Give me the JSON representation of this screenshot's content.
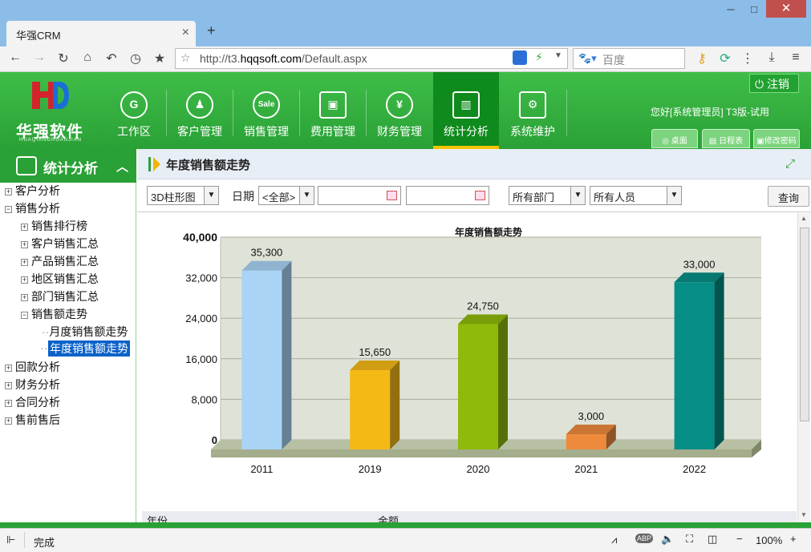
{
  "browser": {
    "tab_title": "华强CRM",
    "tab_close": "×",
    "new_tab": "+",
    "url_prefix": "http://t3.",
    "url_domain": "hqqsoft.com",
    "url_path": "/Default.aspx",
    "search_placeholder": "百度",
    "win_min": "─",
    "win_max": "□",
    "win_close": "✕"
  },
  "header": {
    "logo_text": "华强软件",
    "logo_sub": "HUAQIANGRUANJIAN",
    "logout_label": "注销",
    "greeting": "您好[系统管理员] T3版-试用",
    "modules": [
      {
        "label": "工作区",
        "icon": "G"
      },
      {
        "label": "客户管理",
        "icon": "♟"
      },
      {
        "label": "销售管理",
        "icon": "Sale"
      },
      {
        "label": "费用管理",
        "icon": "▣"
      },
      {
        "label": "财务管理",
        "icon": "¥"
      },
      {
        "label": "统计分析",
        "icon": "▥"
      },
      {
        "label": "系统维护",
        "icon": "⚙"
      }
    ],
    "quick": [
      "桌面",
      "日程表",
      "修改密码"
    ]
  },
  "sidebar": {
    "title": "统计分析",
    "collapse_icon": "︿",
    "items": [
      {
        "label": "客户分析",
        "pm": "+"
      },
      {
        "label": "销售分析",
        "pm": "−"
      },
      {
        "label": "销售排行榜",
        "pm": "+"
      },
      {
        "label": "客户销售汇总",
        "pm": "+"
      },
      {
        "label": "产品销售汇总",
        "pm": "+"
      },
      {
        "label": "地区销售汇总",
        "pm": "+"
      },
      {
        "label": "部门销售汇总",
        "pm": "+"
      },
      {
        "label": "销售额走势",
        "pm": "−"
      },
      {
        "label": "月度销售额走势",
        "pm": ""
      },
      {
        "label": "年度销售额走势",
        "pm": ""
      },
      {
        "label": "回款分析",
        "pm": "+"
      },
      {
        "label": "财务分析",
        "pm": "+"
      },
      {
        "label": "合同分析",
        "pm": "+"
      },
      {
        "label": "售前售后",
        "pm": "+"
      }
    ]
  },
  "content": {
    "title": "年度销售额走势",
    "chart_type_select": "3D柱形图",
    "date_label": "日期",
    "date_range_select": "<全部>",
    "date_from": "",
    "date_to": "",
    "dept_select": "所有部门",
    "person_select": "所有人员",
    "query_button": "查询",
    "table_col_year": "年份",
    "table_col_amount": "金额"
  },
  "status": {
    "text": "完成",
    "zoom": "100%",
    "zoom_minus": "−",
    "zoom_plus": "+"
  },
  "chart_data": {
    "type": "bar",
    "title": "年度销售额走势",
    "categories": [
      "2011",
      "2019",
      "2020",
      "2021",
      "2022"
    ],
    "values": [
      35300,
      15650,
      24750,
      3000,
      33000
    ],
    "value_labels": [
      "35,300",
      "15,650",
      "24,750",
      "3,000",
      "33,000"
    ],
    "bar_colors": [
      "#a9d4f5",
      "#f5b916",
      "#8fba0c",
      "#ee8a3c",
      "#068e86"
    ],
    "ylim": [
      0,
      40000
    ],
    "yticks": [
      "0",
      "8,000",
      "16,000",
      "24,000",
      "32,000",
      "40,000"
    ],
    "grid": true,
    "xlabel": "",
    "ylabel": ""
  }
}
